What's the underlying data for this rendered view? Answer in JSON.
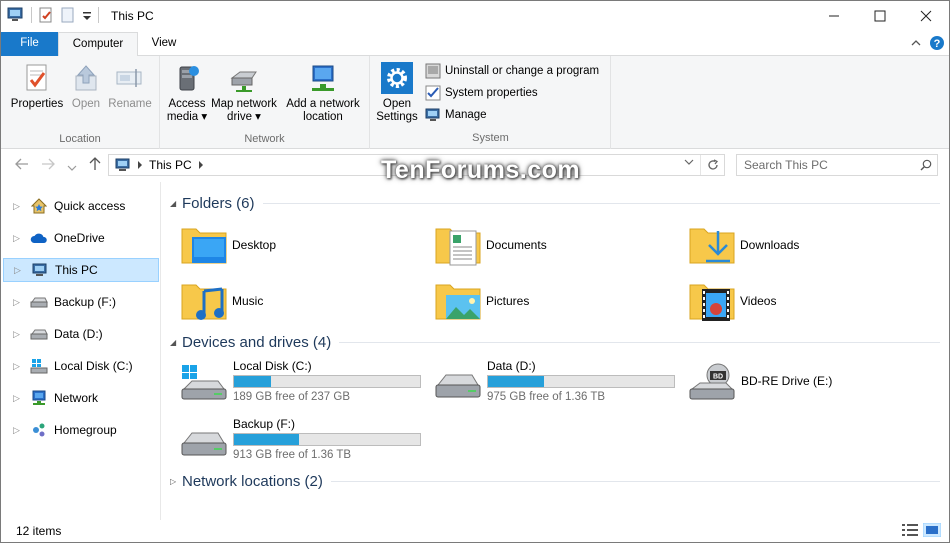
{
  "window": {
    "title": "This PC",
    "controls": {
      "minimize": "—",
      "maximize": "☐",
      "close": "✕"
    }
  },
  "tabs": {
    "file": "File",
    "computer": "Computer",
    "view": "View"
  },
  "ribbon": {
    "location": {
      "label": "Location",
      "properties": "Properties",
      "open": "Open",
      "rename": "Rename"
    },
    "network": {
      "label": "Network",
      "access_media_1": "Access",
      "access_media_2": "media ▾",
      "map_drive_1": "Map network",
      "map_drive_2": "drive ▾",
      "add_location_1": "Add a network",
      "add_location_2": "location"
    },
    "system": {
      "label": "System",
      "open_settings_1": "Open",
      "open_settings_2": "Settings",
      "uninstall": "Uninstall or change a program",
      "system_properties": "System properties",
      "manage": "Manage"
    }
  },
  "address": {
    "crumb": "This PC",
    "search_placeholder": "Search This PC"
  },
  "watermark": "TenForums.com",
  "nav": {
    "items": [
      {
        "label": "Quick access"
      },
      {
        "label": "OneDrive"
      },
      {
        "label": "This PC"
      },
      {
        "label": "Backup (F:)"
      },
      {
        "label": "Data (D:)"
      },
      {
        "label": "Local Disk (C:)"
      },
      {
        "label": "Network"
      },
      {
        "label": "Homegroup"
      }
    ]
  },
  "sections": {
    "folders": "Folders (6)",
    "devices": "Devices and drives (4)",
    "network": "Network locations (2)"
  },
  "folders": [
    {
      "name": "Desktop"
    },
    {
      "name": "Documents"
    },
    {
      "name": "Downloads"
    },
    {
      "name": "Music"
    },
    {
      "name": "Pictures"
    },
    {
      "name": "Videos"
    }
  ],
  "drives": [
    {
      "name": "Local Disk (C:)",
      "free": "189 GB free of 237 GB",
      "used_fraction": 0.2
    },
    {
      "name": "Data (D:)",
      "free": "975 GB free of 1.36 TB",
      "used_fraction": 0.3
    },
    {
      "name": "BD-RE Drive (E:)"
    },
    {
      "name": "Backup (F:)",
      "free": "913 GB free of 1.36 TB",
      "used_fraction": 0.35
    }
  ],
  "status": {
    "item_count": "12 items"
  },
  "colors": {
    "accent": "#1979ca",
    "selection": "#cce8ff",
    "progress": "#26a0da",
    "section_title": "#1e395b"
  }
}
